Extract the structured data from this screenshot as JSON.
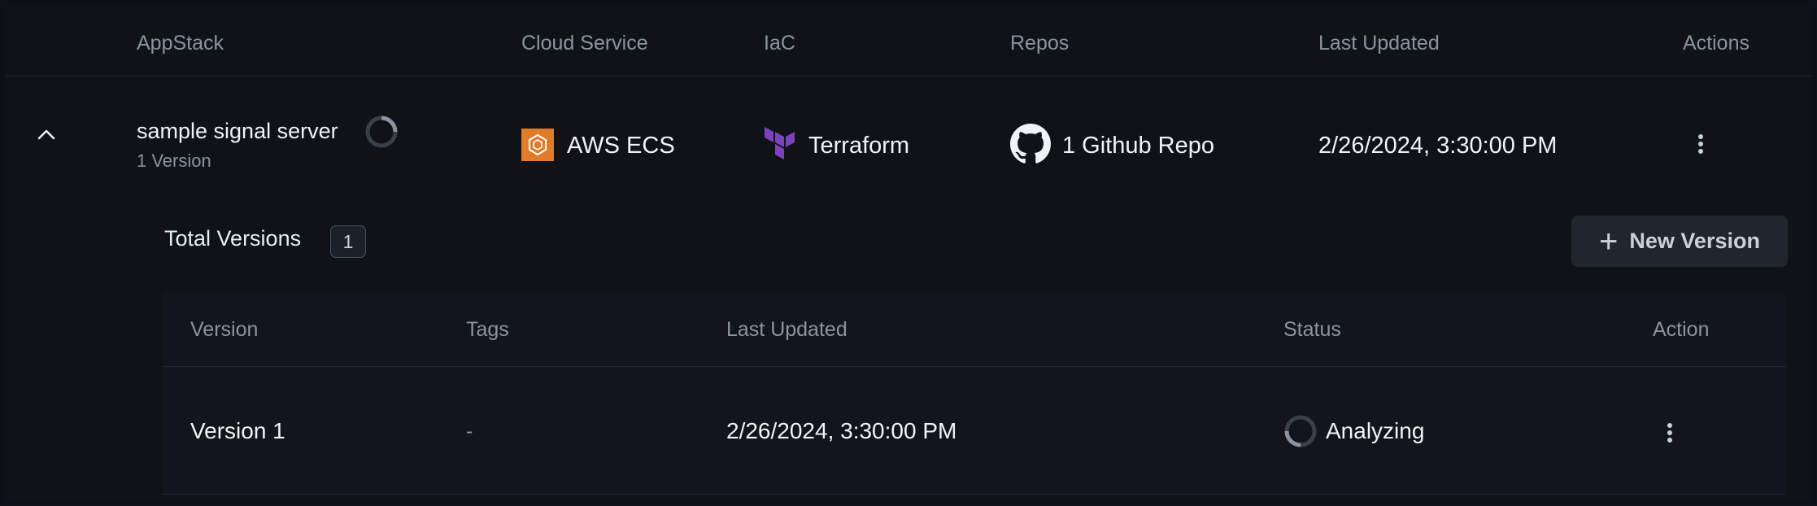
{
  "table": {
    "headers": {
      "appstack": "AppStack",
      "cloud_service": "Cloud Service",
      "iac": "IaC",
      "repos": "Repos",
      "last_updated": "Last Updated",
      "actions": "Actions"
    },
    "row": {
      "name": "sample signal server",
      "version_count": "1 Version",
      "cloud_service": "AWS ECS",
      "iac": "Terraform",
      "repos": "1 Github Repo",
      "last_updated": "2/26/2024, 3:30:00 PM"
    }
  },
  "versions": {
    "title": "Total Versions",
    "count": "1",
    "new_button": "New Version",
    "headers": {
      "version": "Version",
      "tags": "Tags",
      "last_updated": "Last Updated",
      "status": "Status",
      "action": "Action"
    },
    "rows": [
      {
        "version": "Version 1",
        "tags": "-",
        "last_updated": "2/26/2024, 3:30:00 PM",
        "status": "Analyzing"
      }
    ]
  },
  "icons": {
    "expand": "chevron-up-icon",
    "loading": "spinner-icon",
    "cloud": "aws-ecs-icon",
    "iac": "terraform-icon",
    "repo": "github-icon",
    "menu": "more-vertical-icon",
    "add": "plus-icon"
  },
  "colors": {
    "aws_orange": "#e07b2a",
    "terraform_purple": "#7b42bc",
    "background": "#0d1117"
  }
}
